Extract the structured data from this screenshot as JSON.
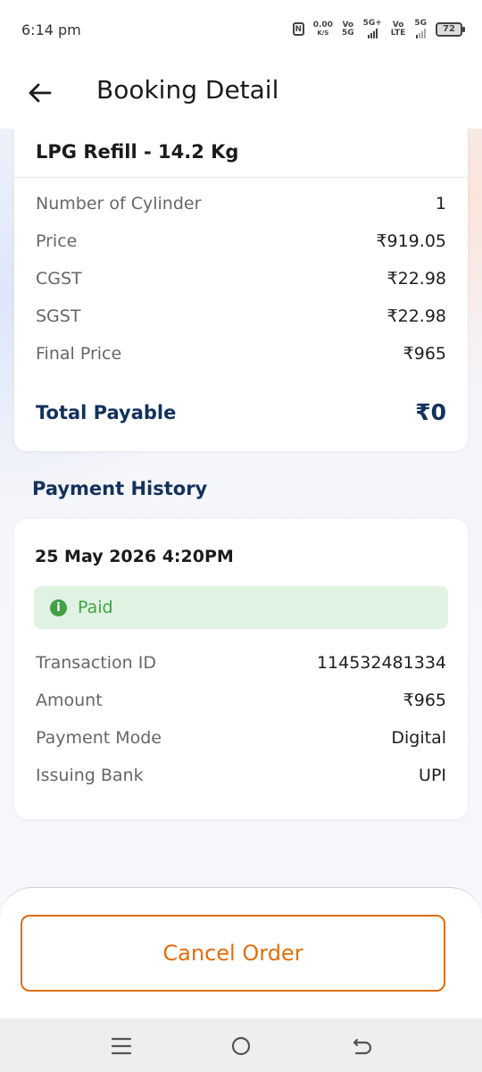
{
  "status_bar": {
    "time": "6:14 pm",
    "net_speed_value": "0.00",
    "net_speed_unit": "K/S",
    "sim1_top": "Vo",
    "sim1_bottom": "5G",
    "sim1_net": "5G+",
    "sim2_top": "Vo",
    "sim2_bottom": "LTE",
    "sim2_net": "5G",
    "battery": "72"
  },
  "header": {
    "title": "Booking Detail",
    "back_icon": "arrow-left-icon"
  },
  "booking": {
    "product": "LPG Refill - 14.2 Kg",
    "rows": [
      {
        "label": "Number of Cylinder",
        "value": "1"
      },
      {
        "label": "Price",
        "value": "₹919.05"
      },
      {
        "label": "CGST",
        "value": "₹22.98"
      },
      {
        "label": "SGST",
        "value": "₹22.98"
      },
      {
        "label": "Final Price",
        "value": "₹965"
      }
    ],
    "total_label": "Total Payable",
    "total_value": "₹0"
  },
  "payment_history": {
    "section_title": "Payment History",
    "date": "25 May 2026 4:20PM",
    "status": "Paid",
    "status_icon": "info-icon",
    "rows": [
      {
        "label": "Transaction ID",
        "value": "114532481334"
      },
      {
        "label": "Amount",
        "value": "₹965"
      },
      {
        "label": "Payment Mode",
        "value": "Digital"
      },
      {
        "label": "Issuing Bank",
        "value": "UPI"
      }
    ]
  },
  "actions": {
    "cancel_label": "Cancel Order"
  },
  "nav": {
    "menu_icon": "menu-icon",
    "home_icon": "home-icon",
    "back_icon": "back-icon"
  },
  "colors": {
    "accent": "#e06e0e",
    "heading": "#13325b",
    "paid_green": "#43a047",
    "paid_bg": "#e0f2e1"
  }
}
